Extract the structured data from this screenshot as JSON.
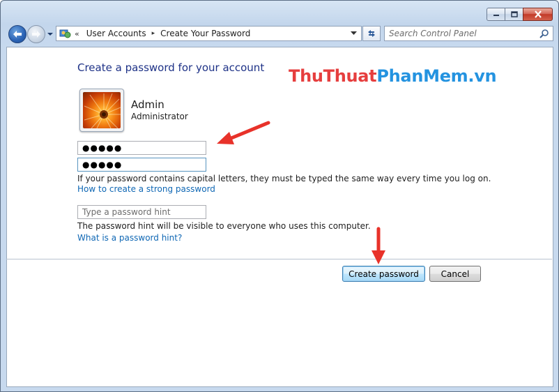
{
  "window": {
    "caption_buttons": [
      "minimize-icon",
      "maximize-icon",
      "close-icon"
    ]
  },
  "nav": {
    "back_icon": "back-arrow-icon",
    "forward_icon": "forward-arrow-icon"
  },
  "address": {
    "chevron": "«",
    "crumbs": [
      "User Accounts",
      "Create Your Password"
    ],
    "separator": "▸"
  },
  "search": {
    "placeholder": "Search Control Panel"
  },
  "main": {
    "title": "Create a password for your account",
    "watermark": {
      "part1": "ThuThuat",
      "part2": "PhanMem",
      "part3": ".vn"
    },
    "user": {
      "name": "Admin",
      "role": "Administrator"
    },
    "password_mask": "●●●●●",
    "confirm_mask": "●●●●●",
    "capital_note": "If your password contains capital letters, they must be typed the same way every time you log on.",
    "strong_link": "How to create a strong password",
    "hint_placeholder": "Type a password hint",
    "hint_note": "The password hint will be visible to everyone who uses this computer.",
    "hint_link": "What is a password hint?"
  },
  "buttons": {
    "create": "Create password",
    "cancel": "Cancel"
  },
  "colors": {
    "title": "#1e3287",
    "link": "#0f67b4",
    "watermark_red": "#e63e3e",
    "watermark_blue": "#2493e0",
    "arrow": "#e8322a"
  }
}
